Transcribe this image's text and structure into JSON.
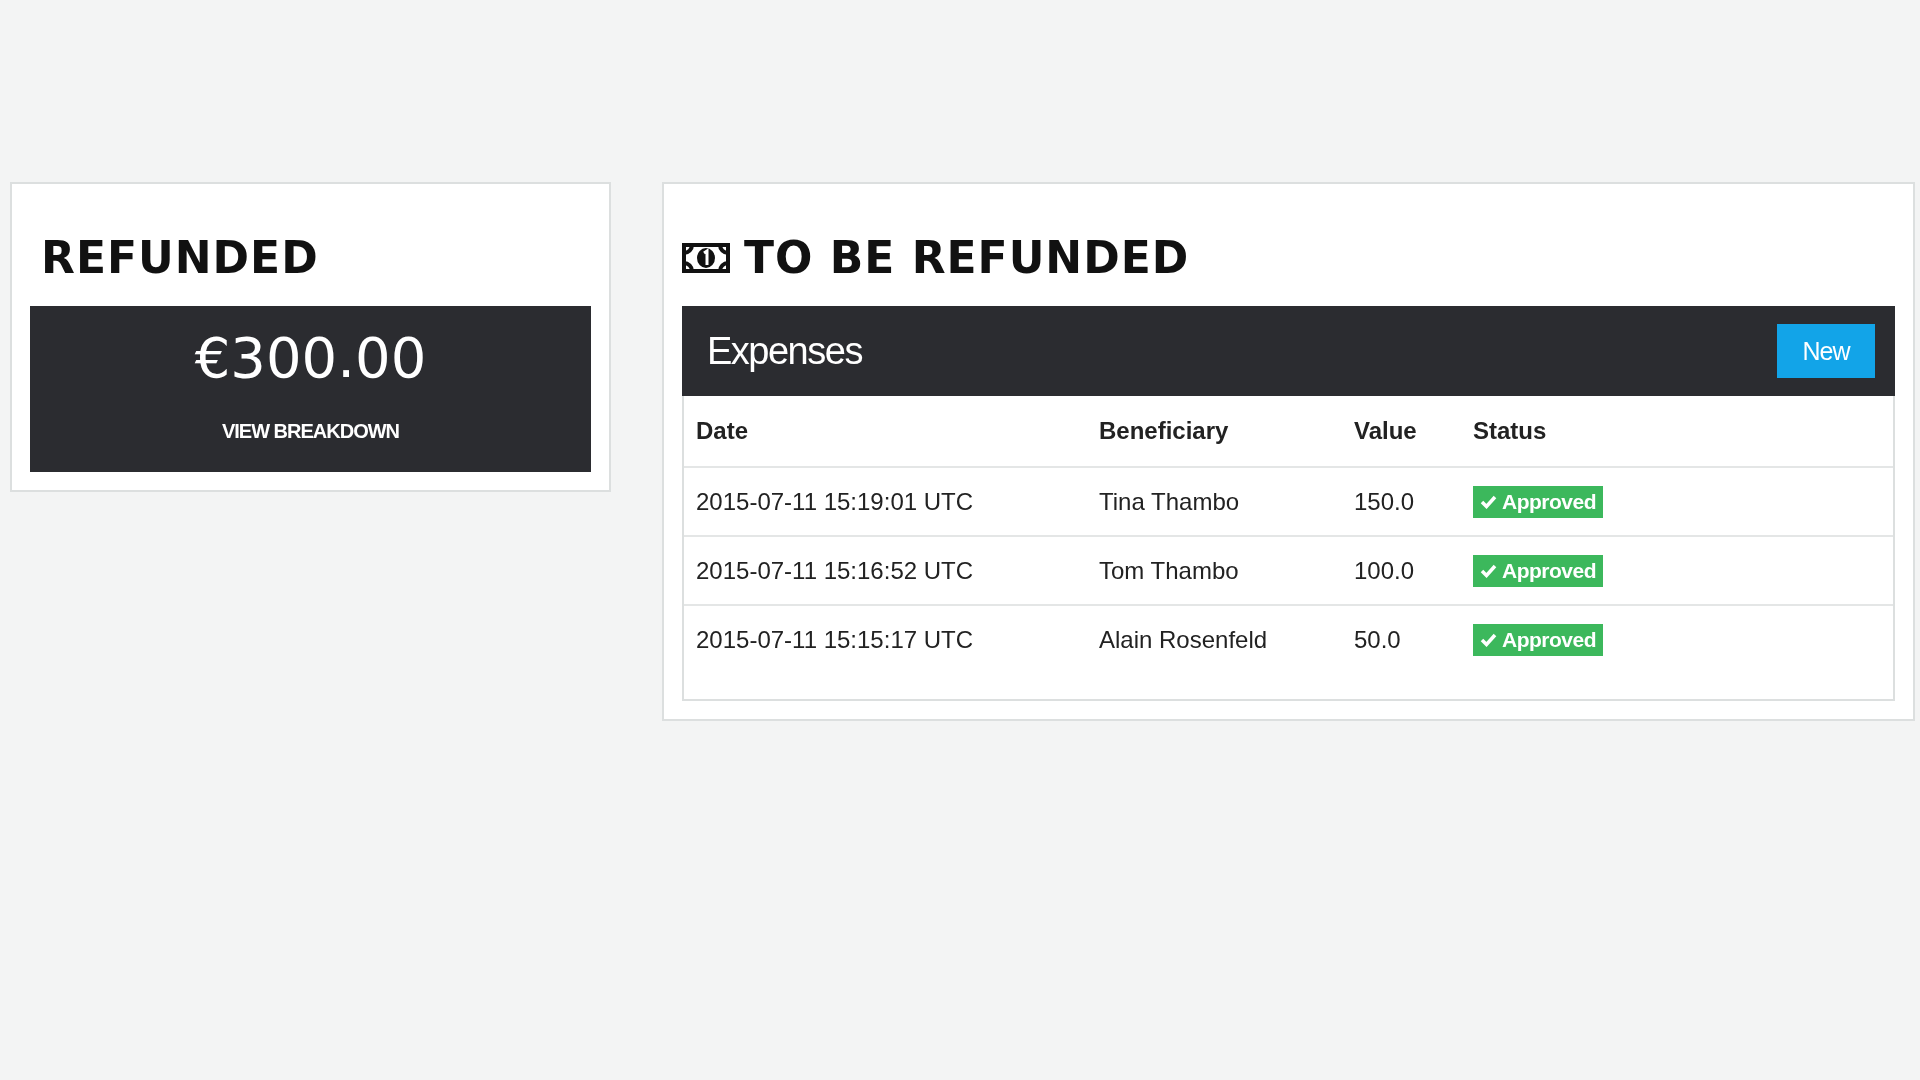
{
  "refunded": {
    "title": "REFUNDED",
    "amount": "€300.00",
    "link": "VIEW BREAKDOWN"
  },
  "to_be_refunded": {
    "title": "TO BE REFUNDED",
    "panel_title": "Expenses",
    "new_button": "New",
    "table": {
      "columns": [
        "Date",
        "Beneficiary",
        "Value",
        "Status"
      ],
      "rows": [
        {
          "date": "2015-07-11 15:19:01 UTC",
          "beneficiary": "Tina Thambo",
          "value": "150.0",
          "status": {
            "label": "Approved",
            "kind": "approved"
          }
        },
        {
          "date": "2015-07-11 15:16:52 UTC",
          "beneficiary": "Tom Thambo",
          "value": "100.0",
          "status": {
            "label": "Approved",
            "kind": "approved"
          }
        },
        {
          "date": "2015-07-11 15:15:17 UTC",
          "beneficiary": "Alain Rosenfeld",
          "value": "50.0",
          "status": {
            "label": "Approved",
            "kind": "approved"
          }
        }
      ]
    }
  }
}
